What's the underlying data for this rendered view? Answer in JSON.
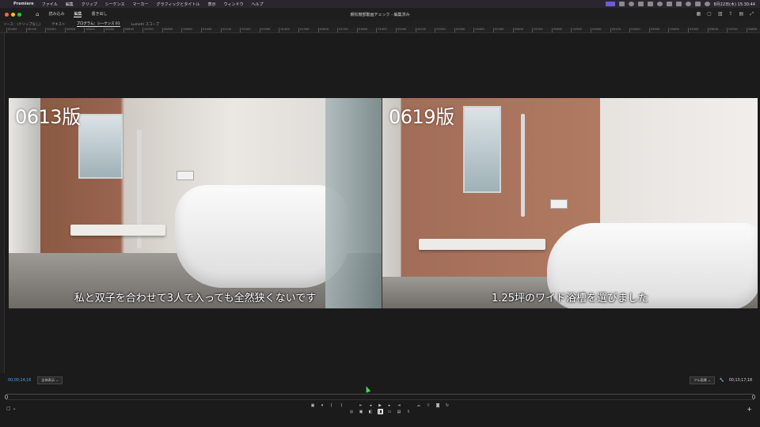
{
  "menubar": {
    "app": "Premiere",
    "items": [
      "ファイル",
      "編集",
      "クリップ",
      "シーケンス",
      "マーカー",
      "グラフィックとタイトル",
      "表示",
      "ウィンドウ",
      "ヘルプ"
    ],
    "right_text": "8月22日(木) 15:30:44"
  },
  "header": {
    "tabs": [
      "読み込み",
      "編集",
      "書き出し"
    ],
    "active_tab": "編集",
    "title": "朝松機部動画チェック - 編集済み"
  },
  "panel_tabs": [
    "ソース：(クリップなし)",
    "テキスト",
    "プログラム：シーケンス 01",
    "Lumetri スコープ"
  ],
  "ruler": [
    "00000",
    "00100",
    "00200",
    "00300",
    "00400",
    "00500",
    "00600",
    "00700",
    "00800",
    "00900",
    "01000",
    "01100",
    "01200",
    "01300",
    "01400",
    "01500",
    "01600",
    "01700",
    "01800",
    "01900",
    "02000",
    "02100",
    "02200",
    "02300",
    "02400",
    "02500",
    "02600",
    "02700",
    "02800",
    "02900",
    "03000",
    "03100",
    "03200",
    "03300",
    "03400",
    "03500",
    "03600",
    "03700",
    "03800"
  ],
  "video": {
    "left": {
      "version": "0613版",
      "subtitle": "私と双子を合わせて3人で入っても全然狭くないです"
    },
    "right": {
      "version": "0619版",
      "subtitle": "1.25坪のワイド浴槽を選びました"
    }
  },
  "status": {
    "timecode": "00;00;14;16",
    "fit": "全体表示",
    "quality": "フル画質",
    "duration": "00;13;17;18"
  },
  "icons": {
    "wrench": "wrench-icon",
    "plus": "plus-icon"
  }
}
